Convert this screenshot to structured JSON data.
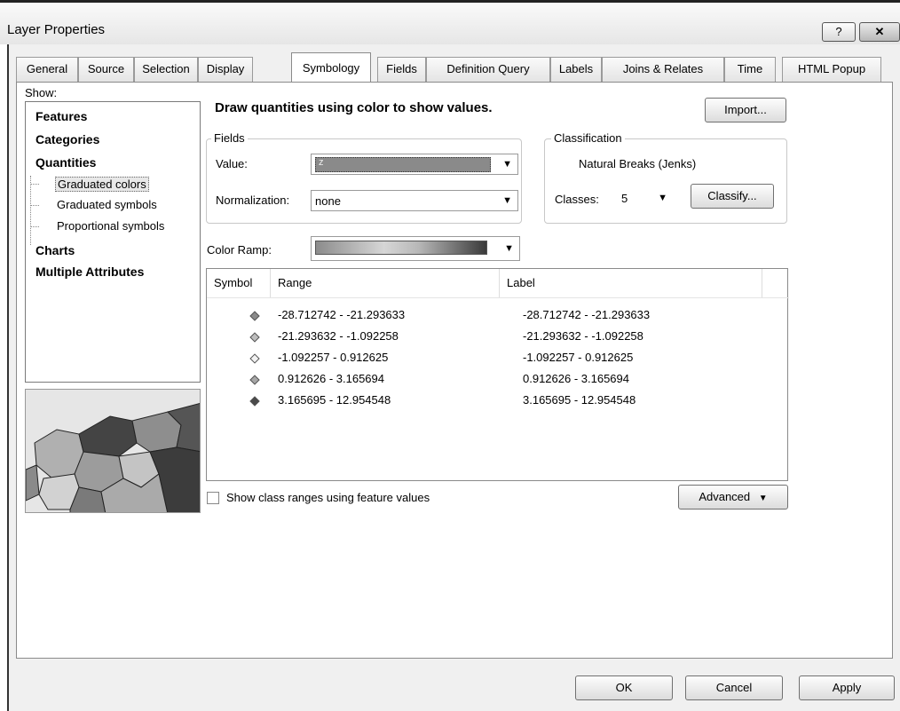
{
  "window": {
    "title": "Layer Properties",
    "help_glyph": "?",
    "close_glyph": "✕"
  },
  "tabs": [
    {
      "label": "General"
    },
    {
      "label": "Source"
    },
    {
      "label": "Selection"
    },
    {
      "label": "Display"
    },
    {
      "label": "Symbology",
      "active": true
    },
    {
      "label": "Fields"
    },
    {
      "label": "Definition Query"
    },
    {
      "label": "Labels"
    },
    {
      "label": "Joins & Relates"
    },
    {
      "label": "Time"
    },
    {
      "label": "HTML Popup"
    }
  ],
  "show": {
    "label": "Show:",
    "items": [
      {
        "label": "Features"
      },
      {
        "label": "Categories"
      },
      {
        "label": "Quantities"
      },
      {
        "label": "Graduated colors",
        "selected": true
      },
      {
        "label": "Graduated symbols"
      },
      {
        "label": "Proportional symbols"
      },
      {
        "label": "Charts"
      },
      {
        "label": "Multiple Attributes"
      }
    ]
  },
  "headline": "Draw quantities using color to show values.",
  "import_label": "Import...",
  "fields": {
    "group_label": "Fields",
    "value_label": "Value:",
    "value": "z",
    "normalization_label": "Normalization:",
    "normalization": "none"
  },
  "classification": {
    "group_label": "Classification",
    "method": "Natural Breaks (Jenks)",
    "classes_label": "Classes:",
    "classes": "5",
    "classify_label": "Classify..."
  },
  "color_ramp": {
    "label": "Color Ramp:",
    "from": "#8c8c8c",
    "to": "#3a3a3a"
  },
  "table": {
    "headers": [
      "Symbol",
      "Range",
      "Label"
    ],
    "rows": [
      {
        "color": "#8a8a8a",
        "range": "-28.712742 - -21.293633",
        "label": "-28.712742 - -21.293633"
      },
      {
        "color": "#bdbdbd",
        "range": "-21.293632 - -1.092258",
        "label": "-21.293632 - -1.092258"
      },
      {
        "color": "#f2f2f2",
        "range": "-1.092257 - 0.912625",
        "label": "-1.092257 - 0.912625"
      },
      {
        "color": "#a6a6a6",
        "range": "0.912626 - 3.165694",
        "label": "0.912626 - 3.165694"
      },
      {
        "color": "#4a4a4a",
        "range": "3.165695 - 12.954548",
        "label": "3.165695 - 12.954548"
      }
    ]
  },
  "show_class_ranges_label": "Show class ranges using feature values",
  "advanced_label": "Advanced",
  "dialog_buttons": {
    "ok": "OK",
    "cancel": "Cancel",
    "apply": "Apply"
  }
}
